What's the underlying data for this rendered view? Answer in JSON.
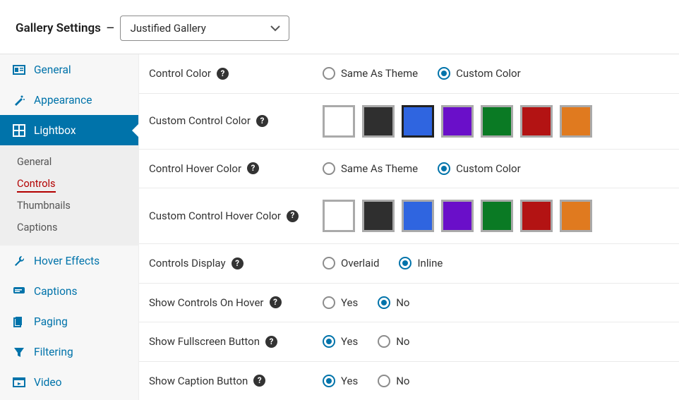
{
  "header": {
    "title": "Gallery Settings",
    "select_value": "Justified Gallery"
  },
  "sidebar": {
    "items": [
      {
        "label": "General"
      },
      {
        "label": "Appearance"
      },
      {
        "label": "Lightbox"
      },
      {
        "label": "Hover Effects"
      },
      {
        "label": "Captions"
      },
      {
        "label": "Paging"
      },
      {
        "label": "Filtering"
      },
      {
        "label": "Video"
      }
    ],
    "subitems": [
      {
        "label": "General"
      },
      {
        "label": "Controls"
      },
      {
        "label": "Thumbnails"
      },
      {
        "label": "Captions"
      }
    ]
  },
  "options": {
    "same_as_theme": "Same As Theme",
    "custom_color": "Custom Color",
    "overlaid": "Overlaid",
    "inline": "Inline",
    "yes": "Yes",
    "no": "No"
  },
  "swatch_colors": [
    "#ffffff",
    "#2f2f2f",
    "#2f65e0",
    "#6a0fc9",
    "#0a7a24",
    "#b31313",
    "#e07a1f"
  ],
  "rows": {
    "control_color": {
      "label": "Control Color",
      "selected": "custom"
    },
    "custom_control_color": {
      "label": "Custom Control Color",
      "selected_index": 2
    },
    "control_hover_color": {
      "label": "Control Hover Color",
      "selected": "custom"
    },
    "custom_control_hover_color": {
      "label": "Custom Control Hover Color",
      "selected_index": -1
    },
    "controls_display": {
      "label": "Controls Display",
      "selected": "inline"
    },
    "show_on_hover": {
      "label": "Show Controls On Hover",
      "selected": "no"
    },
    "show_fullscreen": {
      "label": "Show Fullscreen Button",
      "selected": "yes"
    },
    "show_caption": {
      "label": "Show Caption Button",
      "selected": "yes"
    }
  }
}
